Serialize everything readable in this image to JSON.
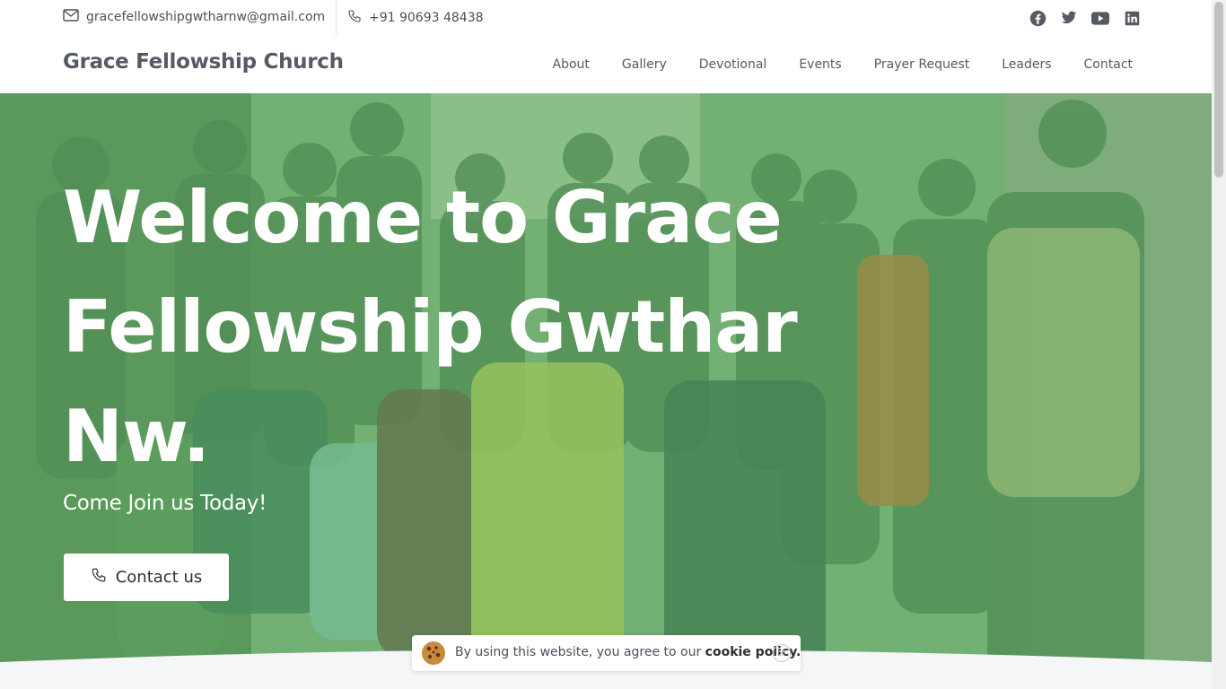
{
  "topbar": {
    "email": "gracefellowshipgwtharnw@gmail.com",
    "phone": "+91 90693 48438",
    "socials": [
      "facebook-icon",
      "twitter-icon",
      "youtube-icon",
      "linkedin-icon"
    ]
  },
  "header": {
    "brand": "Grace Fellowship Church",
    "nav": [
      "About",
      "Gallery",
      "Devotional",
      "Events",
      "Prayer Request",
      "Leaders",
      "Contact"
    ]
  },
  "hero": {
    "title": "Welcome to Grace Fellowship Gwthar Nw.",
    "subtitle": "Come Join us Today!",
    "button_label": "Contact us"
  },
  "cookie": {
    "text_prefix": "By using this website, you agree to our",
    "link_text": "cookie policy."
  },
  "colors": {
    "text_dark": "#555a63",
    "overlay_green": "#6fa776",
    "white": "#ffffff"
  }
}
